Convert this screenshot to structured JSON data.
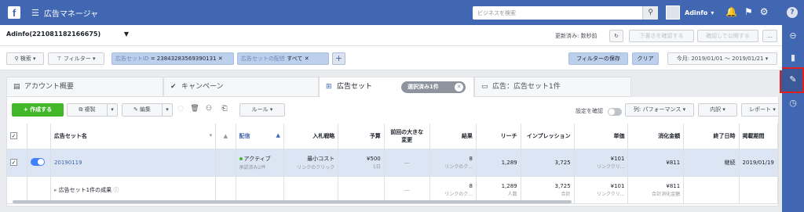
{
  "topbar": {
    "logo": "f",
    "menu_icon": "☰",
    "title": "広告マネージャ",
    "search_placeholder": "ビジネスを検索",
    "account_name": "Adinfo",
    "help": "?"
  },
  "account_bar": {
    "account_select": "Adinfo(221081182166675)",
    "updated": "更新済み: 数秒前",
    "review_button": "下書きを確認する",
    "publish_button": "確認して公開する",
    "more_button": "…"
  },
  "filter_bar": {
    "search_button": "検索",
    "filter_button": "フィルター",
    "chip1_key": "広告セットID",
    "chip1_value": "= 23843283569390131",
    "chip2_key": "広告セットの配信",
    "chip2_value": "すべて",
    "add_button": "+",
    "save_filter_button": "フィルターの保存",
    "clear_button": "クリア",
    "date_range": "今月: 2019/01/01 ～ 2019/01/21"
  },
  "tabs": [
    {
      "label": "アカウント概要"
    },
    {
      "label": "キャンペーン"
    },
    {
      "label": "広告セット"
    },
    {
      "label": "広告：広告セット1件"
    }
  ],
  "selection_badge": "選択済み1件",
  "toolbar": {
    "create": "作成する",
    "duplicate": "複製",
    "edit": "編集",
    "rules": "ルール",
    "settings_check": "設定を確認",
    "columns": "列: パフォーマンス",
    "breakdown": "内訳",
    "reports": "レポート"
  },
  "table": {
    "headers": {
      "name": "広告セット名",
      "delivery": "配信",
      "bid": "入札戦略",
      "budget": "予算",
      "last_change": "前回の大きな変更",
      "results": "結果",
      "reach": "リーチ",
      "impressions": "インプレッション",
      "cost": "単価",
      "spend": "消化金額",
      "end": "終了日時",
      "schedule": "掲載期間"
    },
    "row": {
      "name": "20190119",
      "delivery": "アクティブ",
      "delivery_sub": "承認済み2件",
      "bid": "最小コスト",
      "bid_sub": "リンクのクリック",
      "budget": "¥500",
      "budget_sub": "1日",
      "last_change": "—",
      "results": "8",
      "results_sub": "リンクのク...",
      "reach": "1,289",
      "impressions": "3,725",
      "cost": "¥101",
      "cost_sub": "リンククリ...",
      "spend": "¥811",
      "end": "継続",
      "schedule": "2019/01/19"
    },
    "summary": {
      "label": "広告セット1件の成果",
      "last_change": "—",
      "results": "8",
      "results_sub": "リンクのク...",
      "reach": "1,289",
      "reach_sub": "人数",
      "impressions": "3,725",
      "impressions_sub": "合計",
      "cost": "¥101",
      "cost_sub": "リンククリ...",
      "spend": "¥811",
      "spend_sub": "合計消化金額"
    }
  }
}
